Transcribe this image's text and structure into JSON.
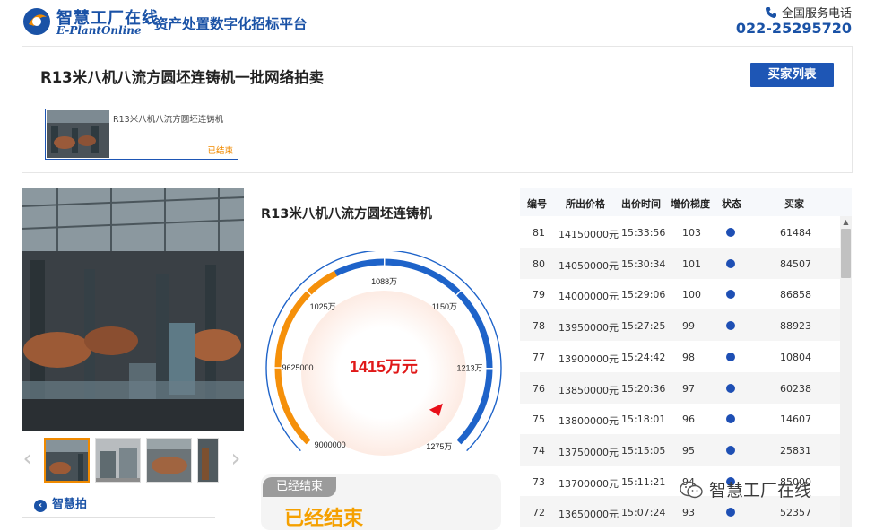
{
  "header": {
    "logo_cn": "智慧工厂在线",
    "logo_en": "E-PlantOnline",
    "slogan": "资产处置数字化招标平台",
    "hotline_label": "全国服务电话",
    "hotline_number": "022-25295720"
  },
  "lot": {
    "title": "R13米八机八流方圆坯连铸机一批网络拍卖",
    "buyer_list_label": "买家列表",
    "card_name": "R13米八机八流方圆坯连铸机",
    "card_status": "已结束"
  },
  "gallery": {
    "prev_label": "‹",
    "next_label": "›",
    "brand_link": "智慧拍"
  },
  "item": {
    "name": "R13米八机八流方圆坯连铸机"
  },
  "gauge": {
    "current_price": "1415万元",
    "current_value_wan": 1415,
    "min_wan": 900,
    "max_wan": 1275,
    "ticks": [
      {
        "label": "9000000",
        "value_wan": 900
      },
      {
        "label": "9625000",
        "value_wan": 962.5
      },
      {
        "label": "1025万",
        "value_wan": 1025
      },
      {
        "label": "1088万",
        "value_wan": 1088
      },
      {
        "label": "1150万",
        "value_wan": 1150
      },
      {
        "label": "1213万",
        "value_wan": 1213
      },
      {
        "label": "1275万",
        "value_wan": 1275
      }
    ],
    "colors": {
      "low": "#f5900a",
      "high": "#1e63c9",
      "pointer": "#e8101a",
      "price": "#e01818"
    }
  },
  "status": {
    "tag": "已经结束",
    "big": "已经结束"
  },
  "bids": {
    "headers": [
      "编号",
      "所出价格",
      "出价时间",
      "增价梯度",
      "状态",
      "买家"
    ],
    "rows": [
      {
        "no": "81",
        "price": "14150000元",
        "time": "15:33:56",
        "step": "103",
        "buyer": "61484"
      },
      {
        "no": "80",
        "price": "14050000元",
        "time": "15:30:34",
        "step": "101",
        "buyer": "84507"
      },
      {
        "no": "79",
        "price": "14000000元",
        "time": "15:29:06",
        "step": "100",
        "buyer": "86858"
      },
      {
        "no": "78",
        "price": "13950000元",
        "time": "15:27:25",
        "step": "99",
        "buyer": "88923"
      },
      {
        "no": "77",
        "price": "13900000元",
        "time": "15:24:42",
        "step": "98",
        "buyer": "10804"
      },
      {
        "no": "76",
        "price": "13850000元",
        "time": "15:20:36",
        "step": "97",
        "buyer": "60238"
      },
      {
        "no": "75",
        "price": "13800000元",
        "time": "15:18:01",
        "step": "96",
        "buyer": "14607"
      },
      {
        "no": "74",
        "price": "13750000元",
        "time": "15:15:05",
        "step": "95",
        "buyer": "25831"
      },
      {
        "no": "73",
        "price": "13700000元",
        "time": "15:11:21",
        "step": "94",
        "buyer": "85000"
      },
      {
        "no": "72",
        "price": "13650000元",
        "time": "15:07:24",
        "step": "93",
        "buyer": "52357"
      }
    ]
  },
  "watermark": "智慧工厂在线"
}
